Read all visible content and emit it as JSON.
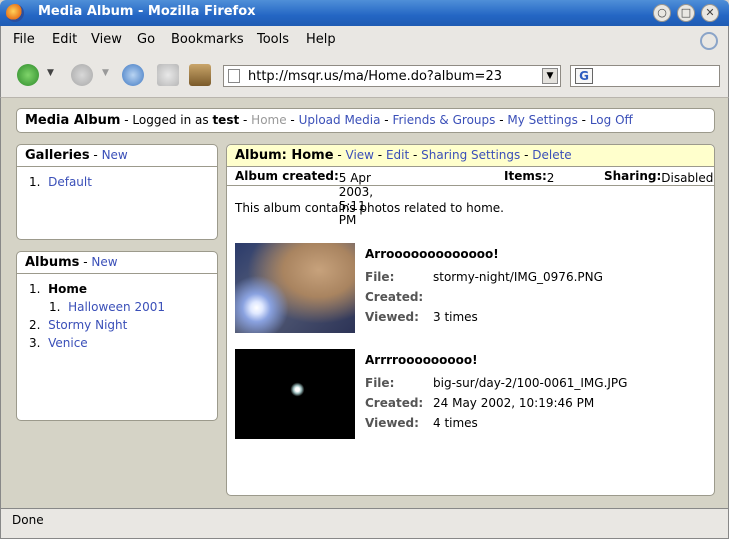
{
  "window": {
    "title": "Media Album - Mozilla Firefox",
    "buttons": {
      "minimize": "○",
      "maximize": "□",
      "close": "✕"
    }
  },
  "menu": [
    "File",
    "Edit",
    "View",
    "Go",
    "Bookmarks",
    "Tools",
    "Help"
  ],
  "toolbar": {
    "url": "http://msqr.us/ma/Home.do?album=23",
    "search_value": ""
  },
  "header": {
    "brand": "Media Album",
    "logged_in_prefix": " - Logged in as ",
    "user": "test",
    "nav": {
      "home": "Home",
      "upload": "Upload Media",
      "friends": "Friends & Groups",
      "settings": "My Settings",
      "logoff": "Log Off"
    }
  },
  "galleries": {
    "title": "Galleries",
    "new_label": "New",
    "items": [
      {
        "num": "1.",
        "label": "Default"
      }
    ]
  },
  "albums": {
    "title": "Albums",
    "new_label": "New",
    "items": [
      {
        "num": "1.",
        "label": "Home",
        "sub": {
          "num": "1.",
          "label": "Halloween 2001"
        }
      },
      {
        "num": "2.",
        "label": "Stormy Night"
      },
      {
        "num": "3.",
        "label": "Venice"
      }
    ]
  },
  "album": {
    "title": "Album: Home",
    "actions": {
      "view": "View",
      "edit": "Edit",
      "sharing": "Sharing Settings",
      "delete": "Delete"
    },
    "created_label": "Album created:",
    "created_value": "5 Apr 2003, 5:11 PM",
    "items_label": "Items:",
    "items_value": "2",
    "sharing_label": "Sharing:",
    "sharing_value": "Disabled",
    "description": "This album contains photos related to home.",
    "field_labels": {
      "file": "File:",
      "created": "Created:",
      "viewed": "Viewed:"
    },
    "media": [
      {
        "title": "Arrooooooooooooo!",
        "file": "stormy-night/IMG_0976.PNG",
        "created": "",
        "viewed": "3 times"
      },
      {
        "title": "Arrrrooooooooo!",
        "file": "big-sur/day-2/100-0061_IMG.JPG",
        "created": "24 May 2002, 10:19:46 PM",
        "viewed": "4 times"
      }
    ]
  },
  "status": {
    "text": "Done"
  },
  "icons": [
    "firefox-icon",
    "back-icon",
    "forward-icon",
    "reload-icon",
    "stop-icon",
    "home-icon",
    "page-icon",
    "google-icon",
    "throbber-icon"
  ]
}
